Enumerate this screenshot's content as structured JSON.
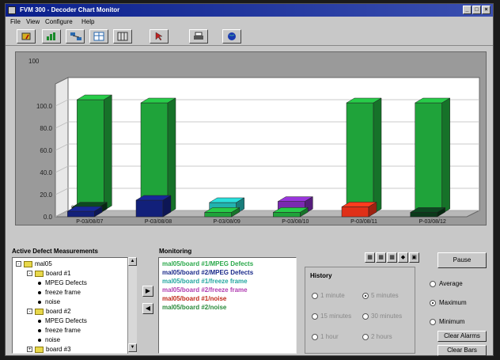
{
  "window": {
    "title": "FVM 300 - Decoder Chart Monitor"
  },
  "menu": [
    "File",
    "View",
    "Configure",
    "Help"
  ],
  "toolbar_icons": [
    "gauge-icon",
    "chart-icon",
    "network-icon",
    "table-icon",
    "grid-icon",
    "pointer-icon",
    "print-icon",
    "globe-icon"
  ],
  "chart_data": {
    "type": "bar",
    "ylabel": "100",
    "yticks": [
      "0.0",
      "20.0",
      "40.0",
      "60.0",
      "80.0",
      "100.0"
    ],
    "categories": [
      "P-03/08/07",
      "P-03/08/08",
      "P-03/08/09",
      "P-03/08/10",
      "P-03/08/11",
      "P-03/08/12"
    ],
    "ylim": [
      0,
      120
    ],
    "series": [
      {
        "color": "#1fa33a",
        "values": [
          100,
          100,
          4,
          4,
          100,
          100
        ]
      },
      {
        "color": "#12207a",
        "values": [
          5,
          15,
          0,
          0,
          0,
          0
        ]
      },
      {
        "color": "#22b3b0",
        "values": [
          0,
          0,
          10,
          0,
          0,
          0
        ]
      },
      {
        "color": "#7a2ab0",
        "values": [
          0,
          0,
          0,
          11,
          0,
          0
        ]
      },
      {
        "color": "#e03018",
        "values": [
          0,
          0,
          0,
          0,
          9,
          0
        ]
      },
      {
        "color": "#0a3a1a",
        "values": [
          6,
          0,
          0,
          0,
          0,
          4
        ]
      }
    ],
    "floor_label": "0.000"
  },
  "left_panel": {
    "title": "Active Defect Measurements",
    "tree": [
      {
        "label": "mal05",
        "level": 0,
        "kind": "folder",
        "expander": "-"
      },
      {
        "label": "board #1",
        "level": 1,
        "kind": "folder",
        "expander": "-"
      },
      {
        "label": "MPEG Defects",
        "level": 2,
        "kind": "leaf"
      },
      {
        "label": "freeze frame",
        "level": 2,
        "kind": "leaf"
      },
      {
        "label": "noise",
        "level": 2,
        "kind": "leaf"
      },
      {
        "label": "board #2",
        "level": 1,
        "kind": "folder",
        "expander": "-"
      },
      {
        "label": "MPEG Defects",
        "level": 2,
        "kind": "leaf"
      },
      {
        "label": "freeze frame",
        "level": 2,
        "kind": "leaf"
      },
      {
        "label": "noise",
        "level": 2,
        "kind": "leaf"
      },
      {
        "label": "board #3",
        "level": 1,
        "kind": "folder",
        "expander": "+"
      }
    ]
  },
  "monitoring": {
    "title": "Monitoring",
    "items": [
      {
        "text": "mal05/board #1/MPEG Defects",
        "color": "#2aa84a"
      },
      {
        "text": "mal05/board #2/MPEG Defects",
        "color": "#1a2a8a"
      },
      {
        "text": "mal05/board #1/freeze frame",
        "color": "#22a6a0"
      },
      {
        "text": "mal05/board #2/freeze frame",
        "color": "#b03cb0"
      },
      {
        "text": "mal05/board #1/noise",
        "color": "#c02818"
      },
      {
        "text": "mal05/board #2/noise",
        "color": "#2a8a3a"
      }
    ]
  },
  "history": {
    "title": "History",
    "options": [
      "1 minute",
      "5 minutes",
      "15 minutes",
      "30 minutes",
      "1 hour",
      "2 hours"
    ],
    "selected": 1
  },
  "mode": {
    "options": [
      "Average",
      "Maximum",
      "Minimum"
    ],
    "selected": 1
  },
  "buttons": {
    "pause": "Pause",
    "clear_alarms": "Clear Alarms",
    "clear_bars": "Clear Bars"
  },
  "colors": {
    "accent": "#0a1f8c",
    "panel": "#c8c8c8"
  }
}
